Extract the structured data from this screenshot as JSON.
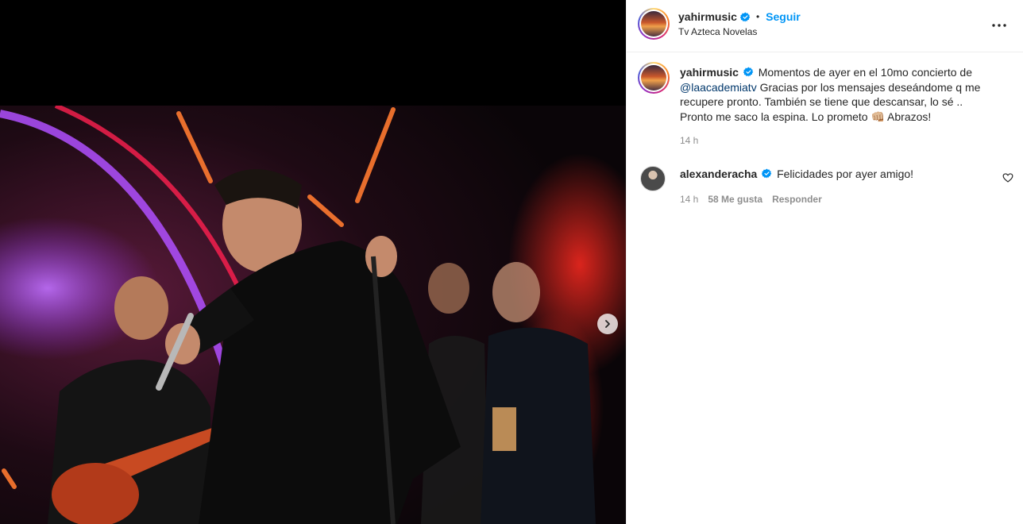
{
  "post": {
    "username": "yahirmusic",
    "separator": "•",
    "follow_label": "Seguir",
    "location": "Tv Azteca Novelas",
    "more_icon": "more-horizontal-icon",
    "next_icon": "chevron-right-icon"
  },
  "caption": {
    "username": "yahirmusic",
    "text_1": "Momentos de ayer en el 10mo concierto de",
    "mention": "@laacademiatv",
    "text_2": "Gracias por los mensajes deseándome q me recupere pronto. También se tiene que descansar, lo sé .. Pronto me saco la espina. Lo prometo",
    "emoji": "👊🏼",
    "text_3": "Abrazos!",
    "time": "14 h"
  },
  "comments": [
    {
      "username": "alexanderacha",
      "text": "Felicidades por ayer amigo!",
      "time": "14 h",
      "likes": "58 Me gusta",
      "reply_label": "Responder"
    }
  ],
  "colors": {
    "link_blue": "#0095f6",
    "mention": "#00376b",
    "secondary_text": "#8e8e8e",
    "verified": "#0095f6"
  }
}
